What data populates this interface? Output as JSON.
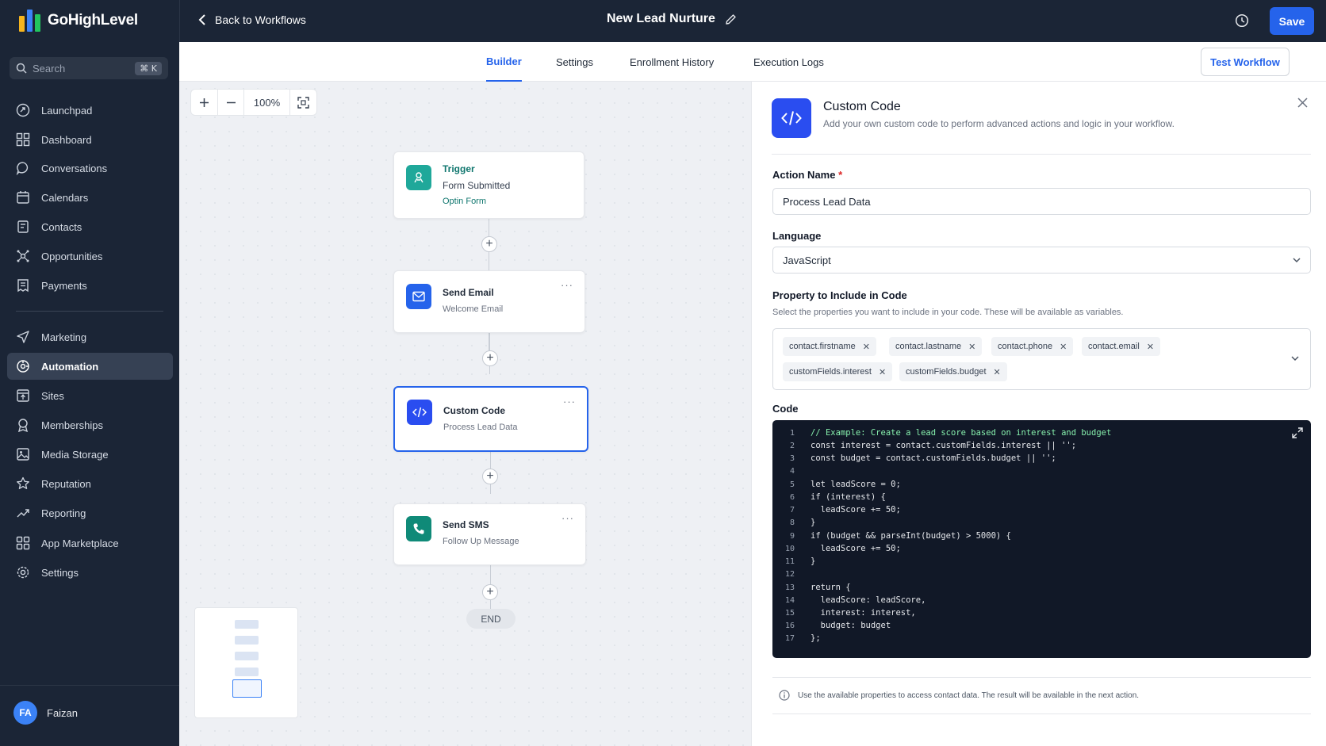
{
  "app": {
    "name": "GoHighLevel"
  },
  "sidebar": {
    "search_placeholder": "Search",
    "search_shortcut": "⌘ K",
    "items": [
      {
        "label": "Launchpad",
        "icon": "launchpad-icon"
      },
      {
        "label": "Dashboard",
        "icon": "dashboard-icon"
      },
      {
        "label": "Conversations",
        "icon": "chat-icon"
      },
      {
        "label": "Calendars",
        "icon": "calendar-icon"
      },
      {
        "label": "Contacts",
        "icon": "contacts-icon"
      },
      {
        "label": "Opportunities",
        "icon": "opportunities-icon"
      },
      {
        "label": "Payments",
        "icon": "payments-icon"
      },
      {
        "label": "Marketing",
        "icon": "send-icon"
      },
      {
        "label": "Automation",
        "icon": "automation-icon",
        "active": true
      },
      {
        "label": "Sites",
        "icon": "sites-icon"
      },
      {
        "label": "Memberships",
        "icon": "memberships-icon"
      },
      {
        "label": "Media Storage",
        "icon": "image-icon"
      },
      {
        "label": "Reputation",
        "icon": "star-icon"
      },
      {
        "label": "Reporting",
        "icon": "trend-icon"
      },
      {
        "label": "App Marketplace",
        "icon": "apps-icon"
      },
      {
        "label": "Settings",
        "icon": "gear-icon"
      }
    ],
    "user": {
      "initials": "FA",
      "name": "Faizan"
    }
  },
  "topbar": {
    "back_label": "Back to Workflows",
    "workflow_title": "New Lead Nurture",
    "save_label": "Save"
  },
  "tabs": {
    "items": [
      "Builder",
      "Settings",
      "Enrollment History",
      "Execution Logs"
    ],
    "active": "Builder",
    "test_label": "Test Workflow"
  },
  "canvas": {
    "zoom_level": "100%",
    "nodes": [
      {
        "title": "Trigger",
        "subtitle": "Form Submitted",
        "detail": "Optin Form"
      },
      {
        "title": "Send Email",
        "subtitle": "Welcome Email"
      },
      {
        "title": "Custom Code",
        "subtitle": "Process Lead Data"
      },
      {
        "title": "Send SMS",
        "subtitle": "Follow Up Message"
      }
    ],
    "end_label": "END",
    "colors": {
      "trigger": "#1fa89a",
      "email": "#2563eb",
      "code": "#2a4df0",
      "sms": "#0f8a78"
    }
  },
  "panel": {
    "title": "Custom Code",
    "subtitle": "Add your own custom code to perform advanced actions and logic in your workflow.",
    "action_name_label": "Action Name",
    "action_name_required": "*",
    "action_name_value": "Process Lead Data",
    "language_label": "Language",
    "language_value": "JavaScript",
    "property_label": "Property to Include in Code",
    "property_hint": "Select the properties you want to include in your code. These will be available as variables.",
    "properties": [
      "contact.firstname",
      "contact.lastname",
      "contact.phone",
      "contact.email",
      "customFields.interest",
      "customFields.budget"
    ],
    "code_label": "Code",
    "code_lines": [
      "// Example: Create a lead score based on interest and budget",
      "const interest = contact.customFields.interest || '';",
      "const budget = contact.customFields.budget || '';",
      "",
      "let leadScore = 0;",
      "if (interest) {",
      "  leadScore += 50;",
      "}",
      "if (budget && parseInt(budget) > 5000) {",
      "  leadScore += 50;",
      "}",
      "",
      "return {",
      "  leadScore: leadScore,",
      "  interest: interest,",
      "  budget: budget",
      "};"
    ],
    "info_text": "Use the available properties to access contact data. The result will be available in the next action."
  }
}
